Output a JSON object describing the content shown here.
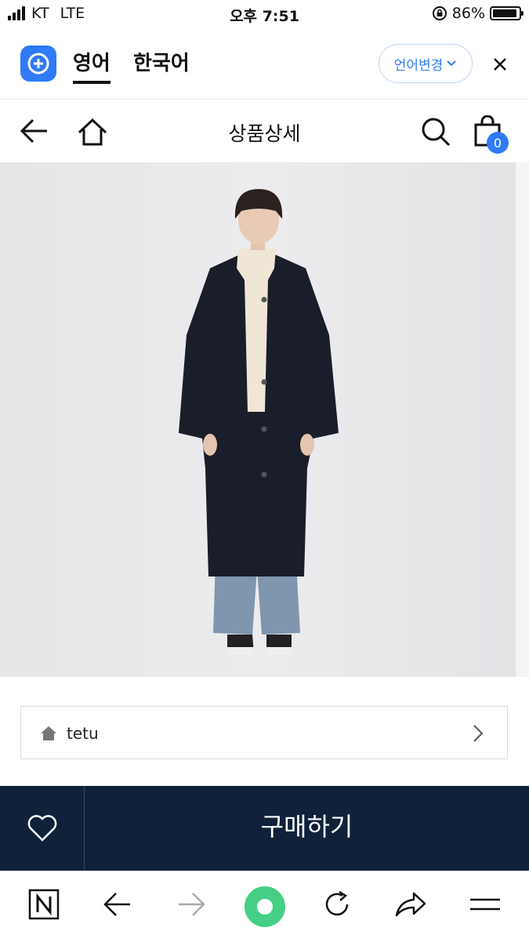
{
  "status_bar": {
    "carrier": "KT",
    "network": "LTE",
    "time": "오후 7:51",
    "battery": "86%"
  },
  "translate_bar": {
    "tabs": [
      "영어",
      "한국어"
    ],
    "active_tab": "영어",
    "language_button": "언어변경"
  },
  "navbar": {
    "title": "상품상세",
    "cart_count": "0"
  },
  "brand": {
    "name": "tetu"
  },
  "purchase": {
    "buy_label": "구매하기"
  },
  "colors": {
    "accent": "#2f7bf5",
    "buy_bar": "#10213a",
    "refresh_button": "#45cf86"
  }
}
